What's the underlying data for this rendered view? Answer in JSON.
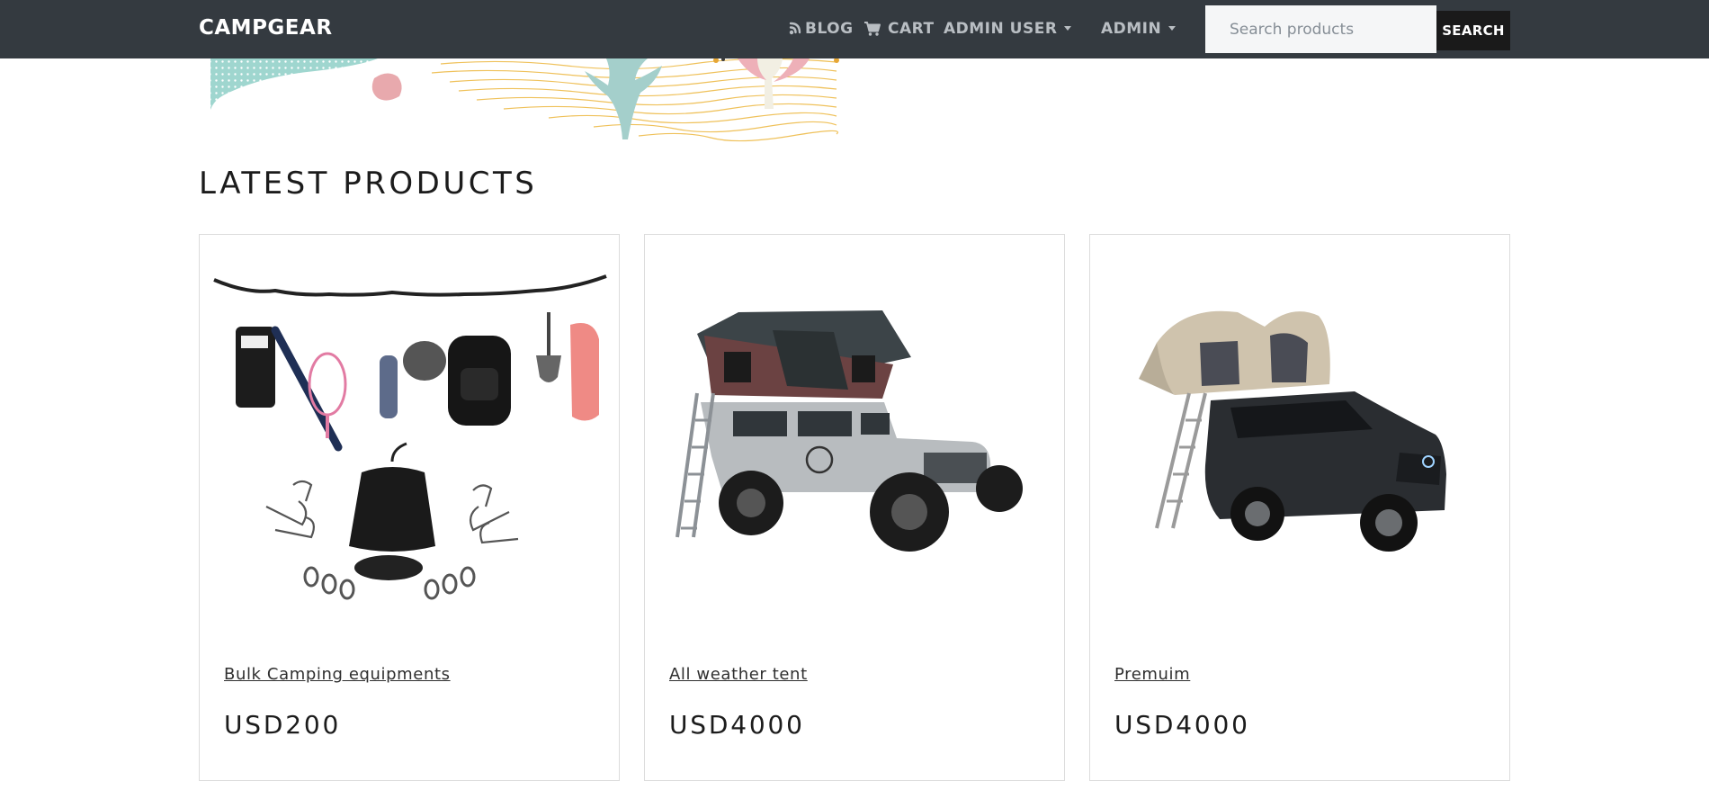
{
  "nav": {
    "brand": "CAMPGEAR",
    "blog_label": "BLOG",
    "cart_label": "CART",
    "admin_user_label": "ADMIN USER",
    "admin_label": "ADMIN",
    "search_placeholder": "Search products",
    "search_button": "SEARCH"
  },
  "main": {
    "heading": "LATEST PRODUCTS",
    "products": [
      {
        "title": "Bulk Camping equipments",
        "price": "USD200",
        "image": "camping-gear-line-icon"
      },
      {
        "title": "All weather tent",
        "price": "USD4000",
        "image": "jeep-rooftop-tent-icon"
      },
      {
        "title": "Premuim",
        "price": "USD4000",
        "image": "suv-rooftop-tent-icon"
      }
    ]
  },
  "colors": {
    "navbar": "#343a40",
    "search_button": "#1a1a1a",
    "card_border": "#dcdcdc"
  }
}
